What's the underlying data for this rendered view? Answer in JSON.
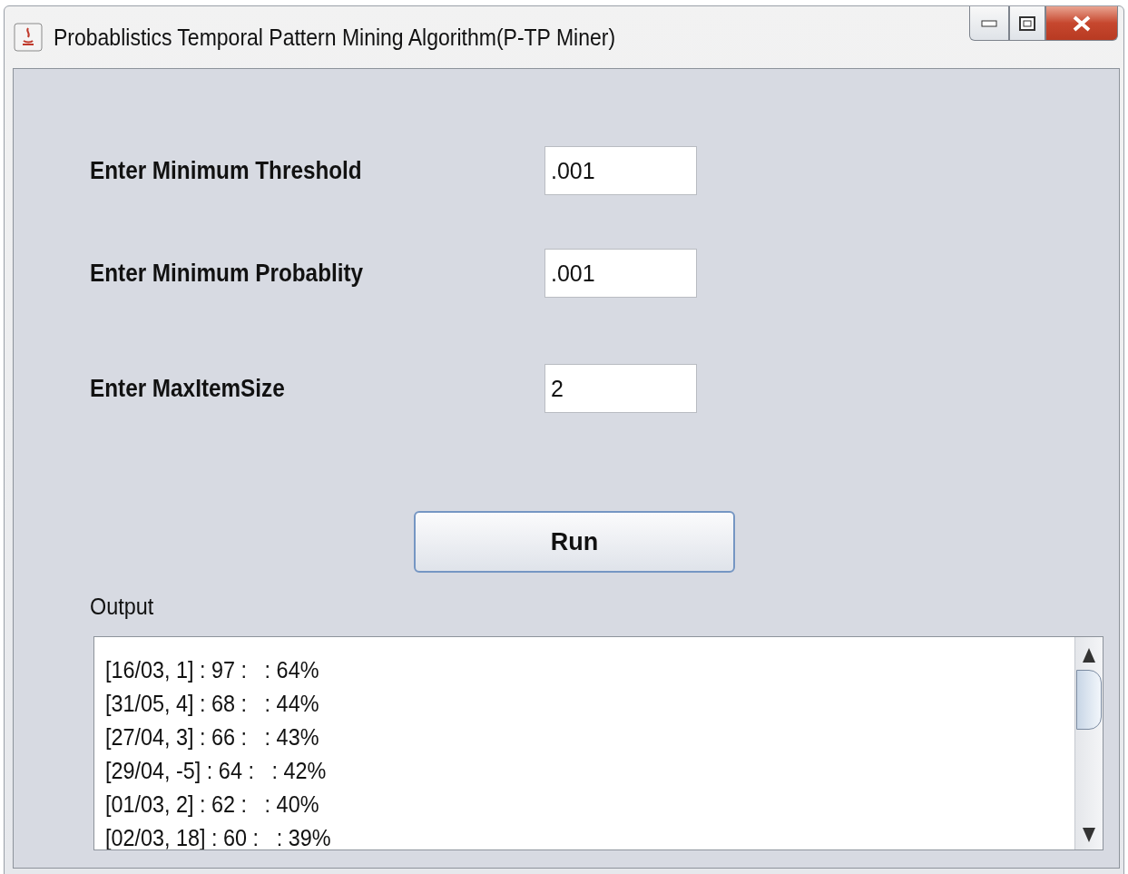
{
  "window": {
    "title": "Probablistics Temporal Pattern Mining Algorithm(P-TP Miner)"
  },
  "fields": [
    {
      "label": "Enter Minimum Threshold",
      "value": ".001"
    },
    {
      "label": "Enter Minimum Probablity",
      "value": ".001"
    },
    {
      "label": "Enter MaxItemSize",
      "value": "2"
    }
  ],
  "run_button": "Run",
  "output": {
    "label": "Output",
    "lines": [
      "[16/03, 1] : 97 :   : 64%",
      "[31/05, 4] : 68 :   : 44%",
      "[27/04, 3] : 66 :   : 43%",
      "[29/04, -5] : 64 :   : 42%",
      "[01/03, 2] : 62 :   : 40%",
      "[02/03, 18] : 60 :   : 39%"
    ]
  }
}
